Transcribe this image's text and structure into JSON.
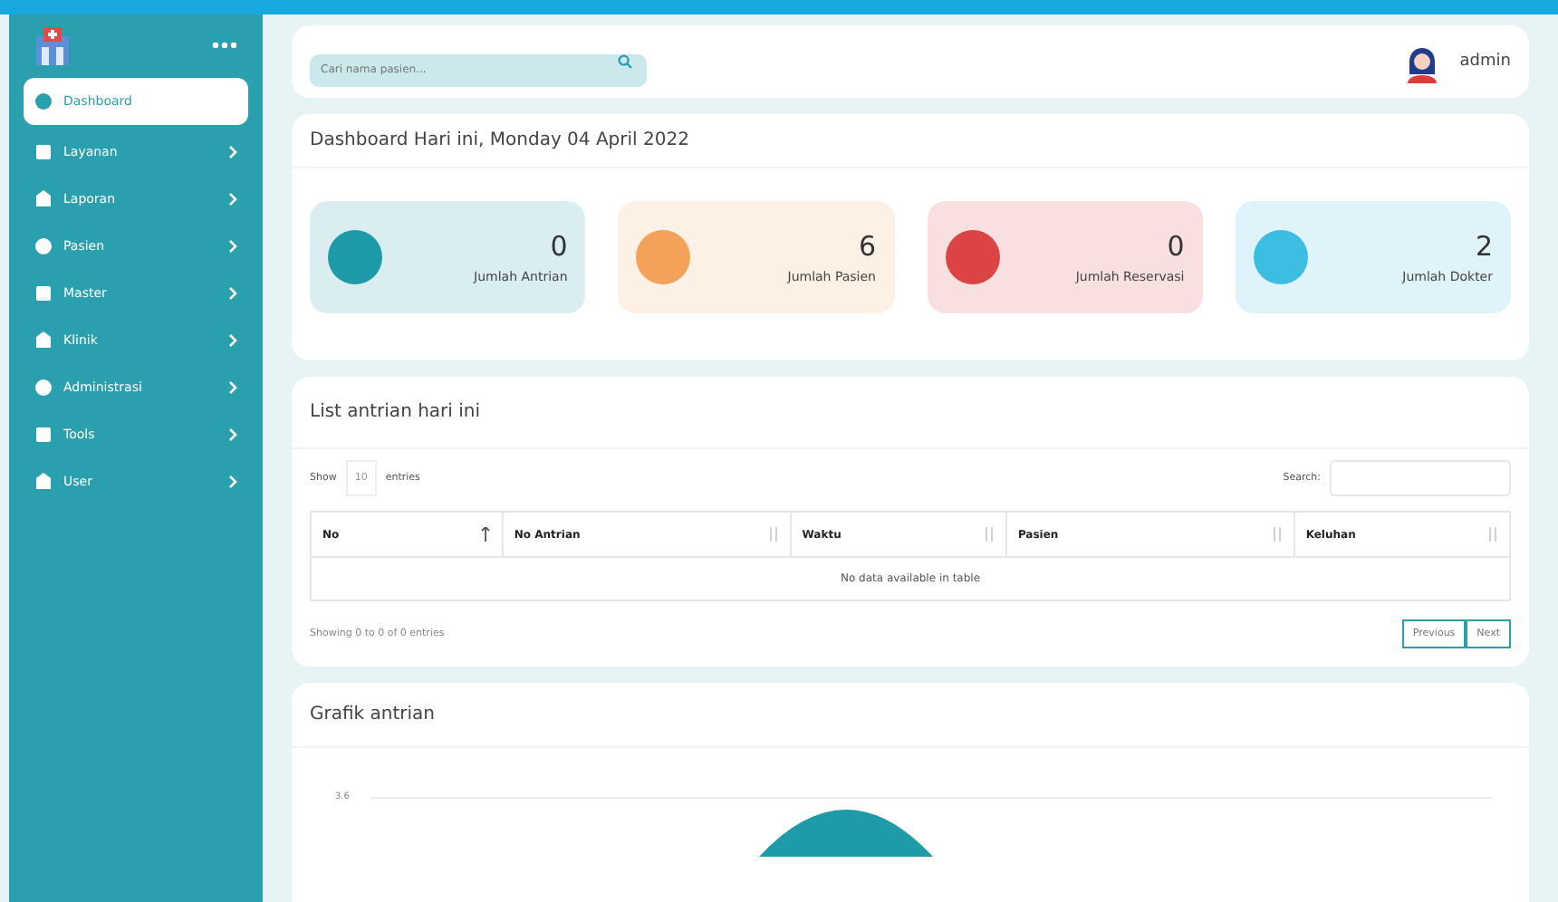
{
  "sidebar": {
    "items": [
      {
        "label": "Dashboard",
        "selected": true,
        "expandable": false
      },
      {
        "label": "Layanan",
        "selected": false,
        "expandable": true
      },
      {
        "label": "Laporan",
        "selected": false,
        "expandable": true
      },
      {
        "label": "Pasien",
        "selected": false,
        "expandable": true
      },
      {
        "label": "Master",
        "selected": false,
        "expandable": true
      },
      {
        "label": "Klinik",
        "selected": false,
        "expandable": true
      },
      {
        "label": "Administrasi",
        "selected": false,
        "expandable": true
      },
      {
        "label": "Tools",
        "selected": false,
        "expandable": true
      },
      {
        "label": "User",
        "selected": false,
        "expandable": true
      }
    ]
  },
  "topbar": {
    "search": {
      "placeholder": "Cari nama pasien..."
    },
    "user": "admin"
  },
  "summary": {
    "title": "Dashboard Hari ini, Monday 04 April 2022",
    "cards": [
      {
        "value": "0",
        "label": "Jumlah Antrian",
        "color": "#1e9aa8"
      },
      {
        "value": "6",
        "label": "Jumlah Pasien",
        "color": "#f4a259"
      },
      {
        "value": "0",
        "label": "Jumlah Reservasi",
        "color": "#dc4444"
      },
      {
        "value": "2",
        "label": "Jumlah Dokter",
        "color": "#3ebde3"
      }
    ]
  },
  "queue": {
    "title": "List antrian hari ini",
    "show_label": "Show",
    "page_size": "10",
    "entries_label": "entries",
    "search_label": "Search:",
    "columns": [
      {
        "label": "No",
        "sorted": true
      },
      {
        "label": "No Antrian",
        "sorted": false
      },
      {
        "label": "Waktu",
        "sorted": false
      },
      {
        "label": "Pasien",
        "sorted": false
      },
      {
        "label": "Keluhan",
        "sorted": false
      }
    ],
    "empty_message": "No data available in table",
    "info": "Showing 0 to 0 of 0 entries",
    "pager": [
      "Previous",
      "Next"
    ]
  },
  "chart": {
    "title": "Grafik antrian",
    "tick_label": "3.6"
  }
}
